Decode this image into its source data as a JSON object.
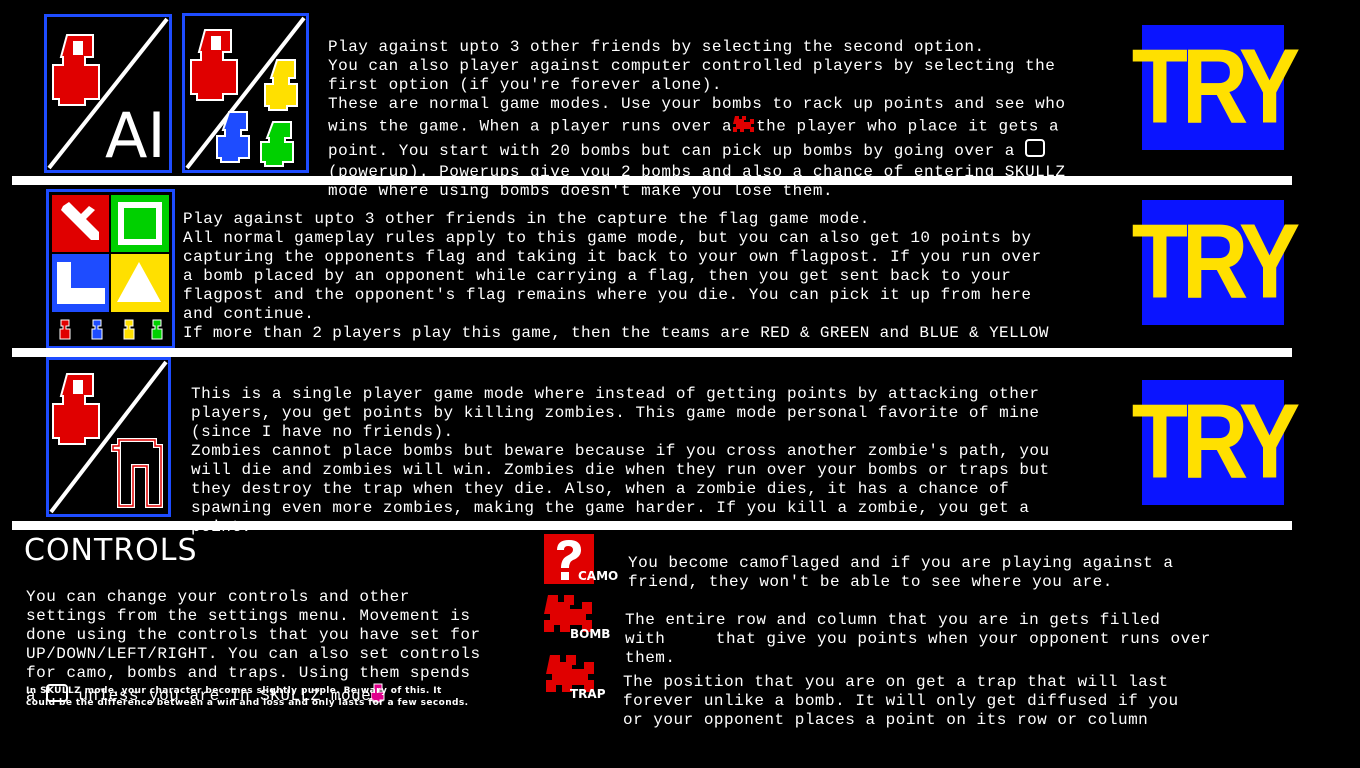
{
  "mode1": {
    "lines": [
      "Play against upto 3 other friends by selecting the second option.",
      "You can also player against computer controlled players by selecting the",
      "first option (if you're forever alone).",
      "These are normal game modes. Use your bombs to rack up points and see who",
      "wins the game. When a player runs over a",
      "the player who place it gets a",
      "point. You start with 20 bombs but can pick up bombs by going over a",
      "(powerup). Powerups give you 2 bombs and also a chance of entering SKULLZ",
      "mode where using bombs doesn't make you lose them."
    ],
    "ai_icon_text": "AI",
    "try_label": "TRY"
  },
  "mode2": {
    "lines": [
      "Play against upto 3 other friends in the capture the flag game mode.",
      "All normal gameplay rules apply to this game mode, but you can also get 10 points by",
      "capturing the opponents flag and taking it back to your own flagpost. If you run over",
      "a bomb placed by an opponent while carrying a flag, then you get sent back to your",
      "flagpost and the opponent's flag remains where you die. You can pick it up from here",
      "and continue.",
      "If more than 2 players play this game, then the teams are RED & GREEN and BLUE & YELLOW"
    ],
    "try_label": "TRY"
  },
  "mode3": {
    "lines": [
      "This is a single player game mode where instead of getting points by attacking other",
      "players, you get points by killing zombies. This game mode personal favorite of mine",
      "(since I have no friends).",
      "Zombies cannot place bombs but beware because if you cross another zombie's path, you",
      "will die and zombies will win. Zombies die when they run over your bombs or traps but",
      "they destroy the trap when they die. Also, when a zombie dies, it has a chance of",
      "spawning even more zombies, making the game harder. If you kill a zombie, you get a",
      "point."
    ],
    "try_label": "TRY"
  },
  "controls": {
    "title": "CONTROLS",
    "lines": [
      "You can change your controls and other",
      "settings from the settings menu. Movement is",
      "done using the controls that you have set for",
      "UP/DOWN/LEFT/RIGHT. You can also set controls",
      "for camo, bombs and traps. Using them spends",
      "a",
      "unless you are in SKULLZ mode"
    ],
    "note_lines": [
      "In SKULLZ mode, your character becomes slightly purple. Be wary of this. It",
      "could be the difference between a win and loss and only lasts for a few seconds."
    ]
  },
  "powerups": {
    "camo": {
      "label": "CAMO",
      "lines": [
        "You become camoflaged and if you are playing against a",
        "friend, they won't be able to see where you are."
      ]
    },
    "bomb": {
      "label": "BOMB",
      "lines": [
        "The entire row and column that you are in gets filled",
        "with",
        "that give you points when your opponent runs over",
        "them."
      ]
    },
    "trap": {
      "label": "TRAP",
      "lines": [
        "The position that you are on get a trap that will last",
        "forever unlike a bomb. It will only get diffused if you",
        "or your opponent places a point on its row or column"
      ]
    }
  },
  "colors": {
    "accent_blue": "#1e4cff",
    "try_bg": "#0a14ff",
    "try_fg": "#ffe000",
    "red": "#ff0000",
    "green": "#00d000",
    "yellow": "#ffe000",
    "blue": "#1e4cff"
  }
}
